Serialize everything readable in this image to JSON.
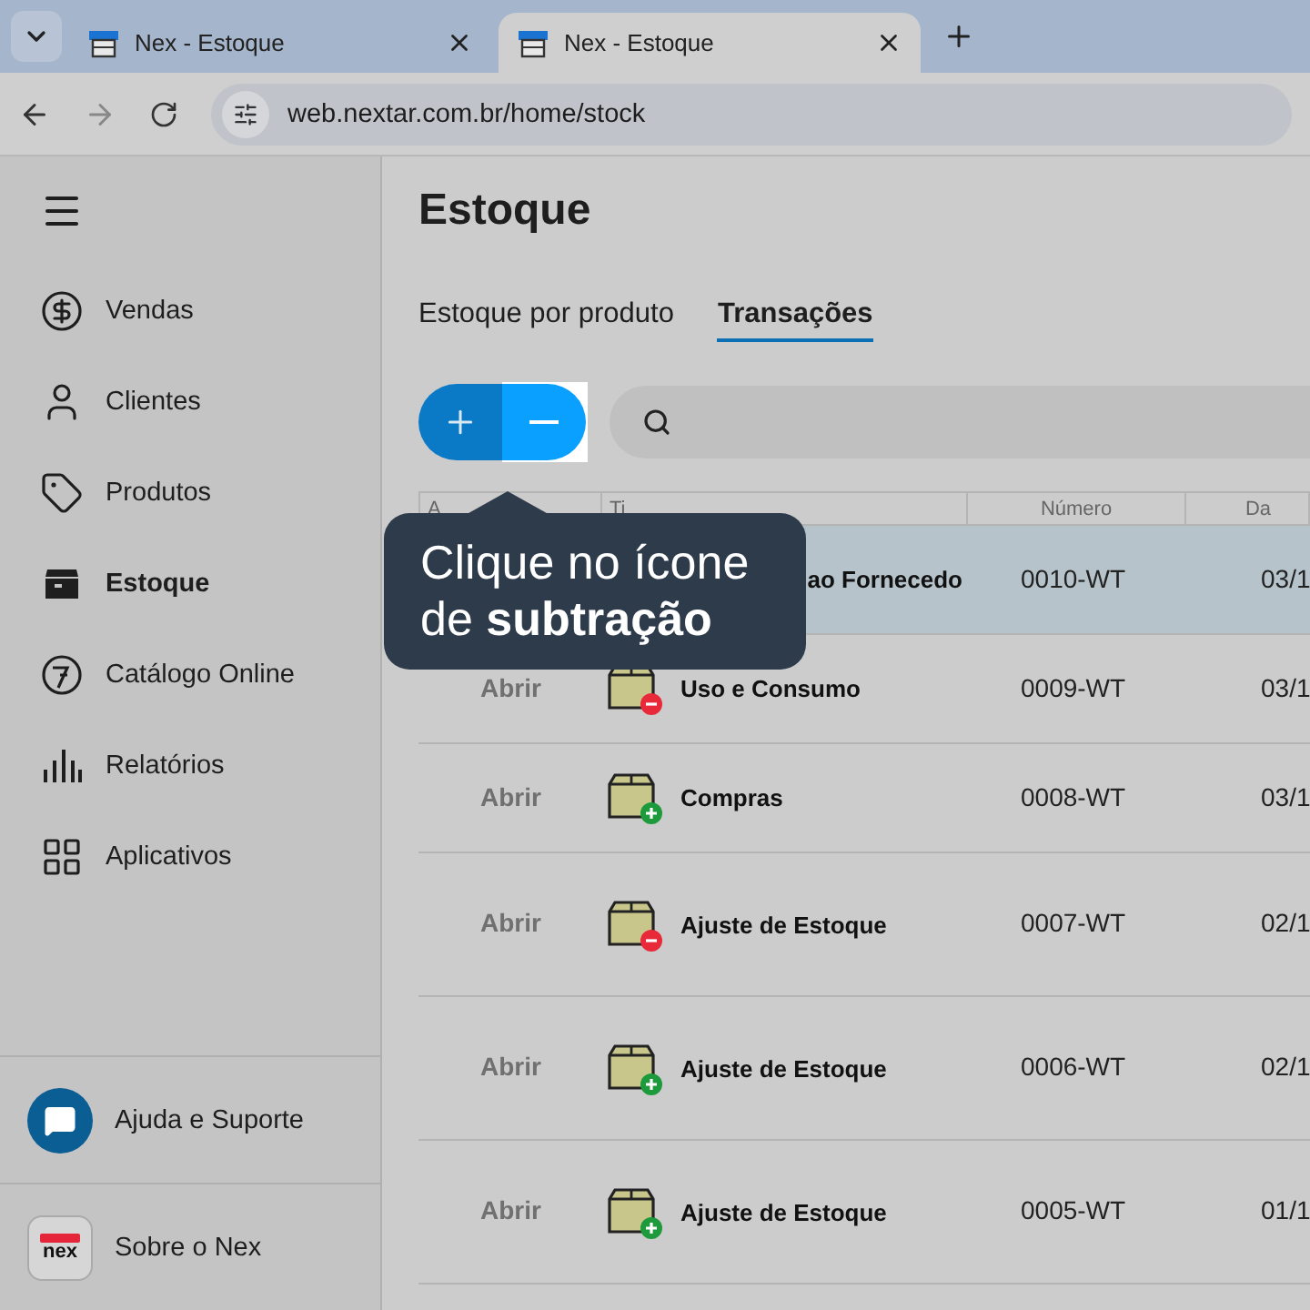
{
  "browser": {
    "tabs": [
      {
        "title": "Nex - Estoque",
        "selected": false
      },
      {
        "title": "Nex - Estoque",
        "selected": true
      }
    ],
    "url": "web.nextar.com.br/home/stock"
  },
  "sidebar": {
    "items": [
      {
        "label": "Vendas",
        "selected": false
      },
      {
        "label": "Clientes",
        "selected": false
      },
      {
        "label": "Produtos",
        "selected": false
      },
      {
        "label": "Estoque",
        "selected": true
      },
      {
        "label": "Catálogo Online",
        "selected": false
      },
      {
        "label": "Relatórios",
        "selected": false
      },
      {
        "label": "Aplicativos",
        "selected": false
      }
    ],
    "footer": [
      {
        "label": "Ajuda e Suporte",
        "kind": "help"
      },
      {
        "label": "Sobre o Nex",
        "kind": "about",
        "logo_text": "nex"
      }
    ]
  },
  "page": {
    "title": "Estoque",
    "tabs": [
      {
        "label": "Estoque por produto",
        "selected": false
      },
      {
        "label": "Transações",
        "selected": true
      }
    ],
    "table": {
      "columns": [
        "A",
        "Ti",
        "Número",
        "Da"
      ],
      "rows": [
        {
          "type": "ao Fornecedo",
          "number": "0010-WT",
          "date": "03/1",
          "selected": true
        },
        {
          "action": "Abrir",
          "kind": "out",
          "type": "Uso e Consumo",
          "number": "0009-WT",
          "date": "03/1",
          "selected": false
        },
        {
          "action": "Abrir",
          "kind": "in",
          "type": "Compras",
          "number": "0008-WT",
          "date": "03/1",
          "selected": false
        },
        {
          "action": "Abrir",
          "kind": "out",
          "type": "Ajuste de Estoque",
          "number": "0007-WT",
          "date": "02/1",
          "selected": false
        },
        {
          "action": "Abrir",
          "kind": "in",
          "type": "Ajuste de Estoque",
          "number": "0006-WT",
          "date": "02/1",
          "selected": false
        },
        {
          "action": "Abrir",
          "kind": "in",
          "type": "Ajuste de Estoque",
          "number": "0005-WT",
          "date": "01/1",
          "selected": false
        }
      ]
    },
    "tooltip": {
      "text": "Clique no ícone de **subtração**"
    }
  }
}
